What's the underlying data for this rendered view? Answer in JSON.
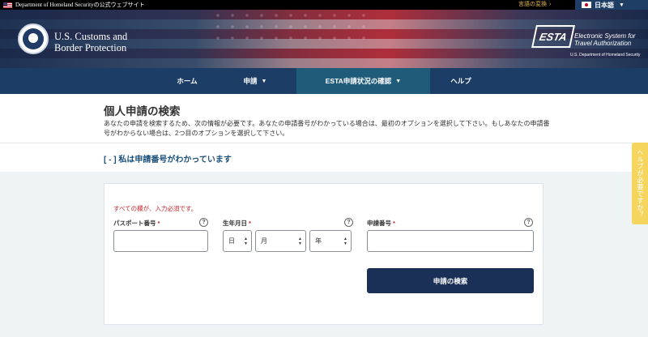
{
  "topbar": {
    "gov_text": "Department of Homeland Securityの公式ウェブサイト",
    "lang_change": "言語の変換",
    "lang_selected": "日本語"
  },
  "header": {
    "agency_line1": "U.S. Customs and",
    "agency_line2": "Border Protection",
    "esta_mark": "ESTA",
    "esta_desc_line1": "Electronic System for",
    "esta_desc_line2": "Travel Authorization",
    "esta_sub": "U.S. Department of Homeland Security"
  },
  "nav": {
    "items": [
      {
        "label": "ホーム",
        "dropdown": false
      },
      {
        "label": "申請",
        "dropdown": true
      },
      {
        "label": "ESTA申請状況の確認",
        "dropdown": true,
        "active": true
      },
      {
        "label": "ヘルプ",
        "dropdown": false
      }
    ]
  },
  "main": {
    "title": "個人申請の検索",
    "description": "あなたの申請を検索するため、次の情報が必要です。あなたの申請番号がわかっている場合は、最初のオプションを選択して下さい。もしあなたの申請番号がわからない場合は、2つ目のオプションを選択して下さい。",
    "section_toggle": "[ - ] 私は申請番号がわかっています"
  },
  "form": {
    "required_note": "すべての欄が、入力必須です。",
    "passport_label": "パスポート番号",
    "dob_label": "生年月日",
    "app_number_label": "申請番号",
    "required_mark": "*",
    "help_glyph": "?",
    "day_placeholder": "日",
    "month_placeholder": "月",
    "year_placeholder": "年",
    "passport_value": "",
    "app_number_value": "",
    "search_button": "申請の検索"
  },
  "help_tab": {
    "label": "ヘルプが必要ですか？"
  },
  "colors": {
    "nav_bg": "#1b3d66",
    "nav_active": "#1f5c7a",
    "button_bg": "#1b3056",
    "required_red": "#c6262e",
    "help_tab": "#f6d55e"
  }
}
